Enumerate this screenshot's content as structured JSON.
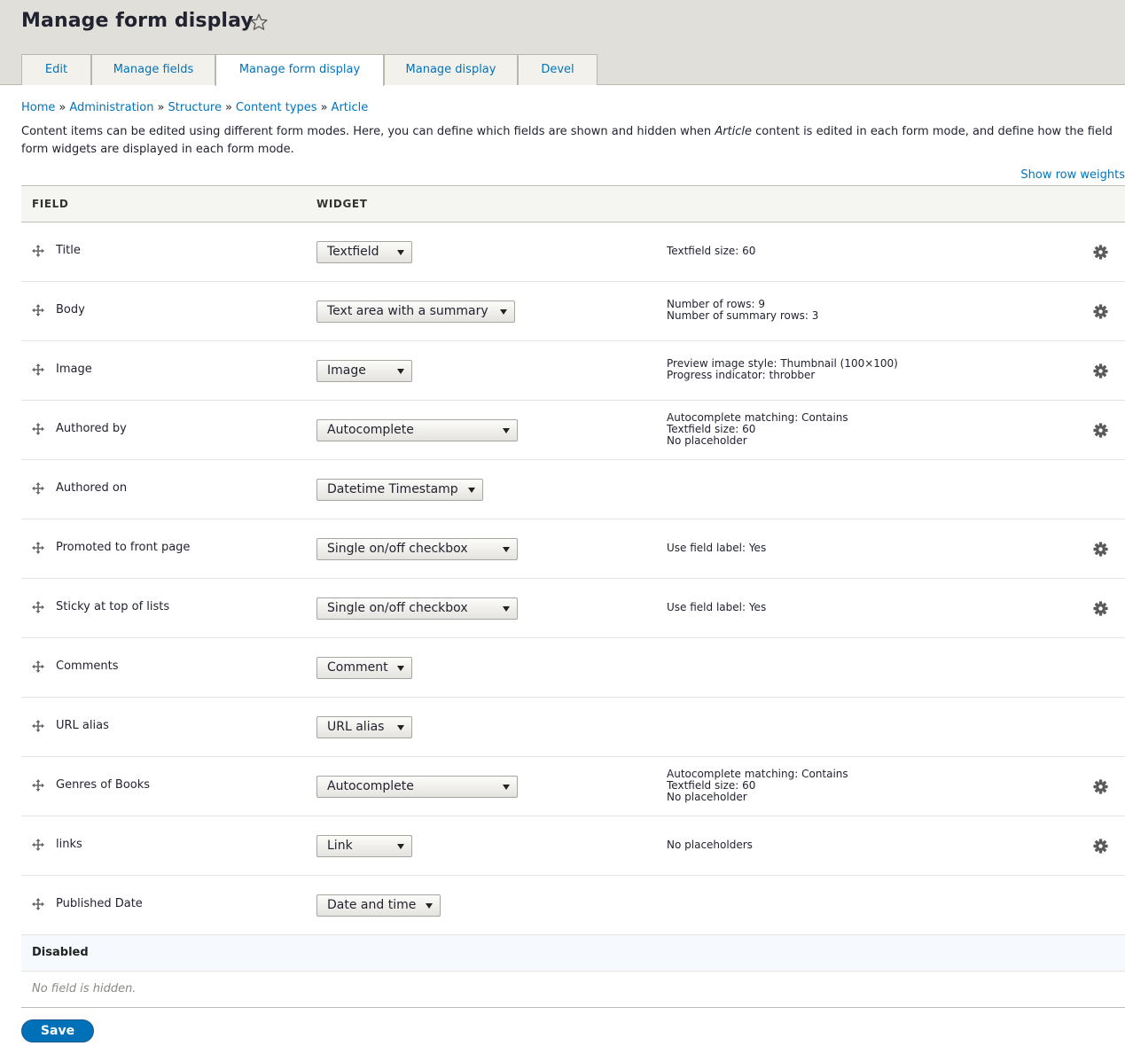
{
  "page": {
    "title": "Manage form display",
    "show_row_weights": "Show row weights",
    "help_before": "Content items can be edited using different form modes. Here, you can define which fields are shown and hidden when ",
    "help_emphasis": "Article",
    "help_after": " content is edited in each form mode, and define how the field form widgets are displayed in each form mode."
  },
  "tabs": [
    {
      "label": "Edit",
      "active": false
    },
    {
      "label": "Manage fields",
      "active": false
    },
    {
      "label": "Manage form display",
      "active": true
    },
    {
      "label": "Manage display",
      "active": false
    },
    {
      "label": "Devel",
      "active": false
    }
  ],
  "breadcrumb": [
    "Home",
    "Administration",
    "Structure",
    "Content types",
    "Article"
  ],
  "breadcrumb_separator": "»",
  "table": {
    "headers": {
      "field": "FIELD",
      "widget": "WIDGET"
    },
    "rows": [
      {
        "field": "Title",
        "widget": "Textfield",
        "summary": [
          "Textfield size: 60"
        ],
        "has_settings": true
      },
      {
        "field": "Body",
        "widget": "Text area with a summary",
        "summary": [
          "Number of rows: 9",
          "Number of summary rows: 3"
        ],
        "has_settings": true
      },
      {
        "field": "Image",
        "widget": "Image",
        "summary": [
          "Preview image style: Thumbnail (100×100)",
          "Progress indicator: throbber"
        ],
        "has_settings": true
      },
      {
        "field": "Authored by",
        "widget": "Autocomplete",
        "summary": [
          "Autocomplete matching: Contains",
          "Textfield size: 60",
          "No placeholder"
        ],
        "has_settings": true
      },
      {
        "field": "Authored on",
        "widget": "Datetime Timestamp",
        "summary": [],
        "has_settings": false
      },
      {
        "field": "Promoted to front page",
        "widget": "Single on/off checkbox",
        "summary": [
          "Use field label: Yes"
        ],
        "has_settings": true
      },
      {
        "field": "Sticky at top of lists",
        "widget": "Single on/off checkbox",
        "summary": [
          "Use field label: Yes"
        ],
        "has_settings": true
      },
      {
        "field": "Comments",
        "widget": "Comment",
        "summary": [],
        "has_settings": false
      },
      {
        "field": "URL alias",
        "widget": "URL alias",
        "summary": [],
        "has_settings": false
      },
      {
        "field": "Genres of Books",
        "widget": "Autocomplete",
        "summary": [
          "Autocomplete matching: Contains",
          "Textfield size: 60",
          "No placeholder"
        ],
        "has_settings": true
      },
      {
        "field": "links",
        "widget": "Link",
        "summary": [
          "No placeholders"
        ],
        "has_settings": true
      },
      {
        "field": "Published Date",
        "widget": "Date and time",
        "summary": [],
        "has_settings": false
      }
    ],
    "disabled_region_label": "Disabled",
    "no_hidden_text": "No field is hidden."
  },
  "actions": {
    "save_label": "Save"
  },
  "colors": {
    "link": "#0074bd",
    "primary_button": "#0071b8",
    "header_bg": "#e0dfd9"
  }
}
